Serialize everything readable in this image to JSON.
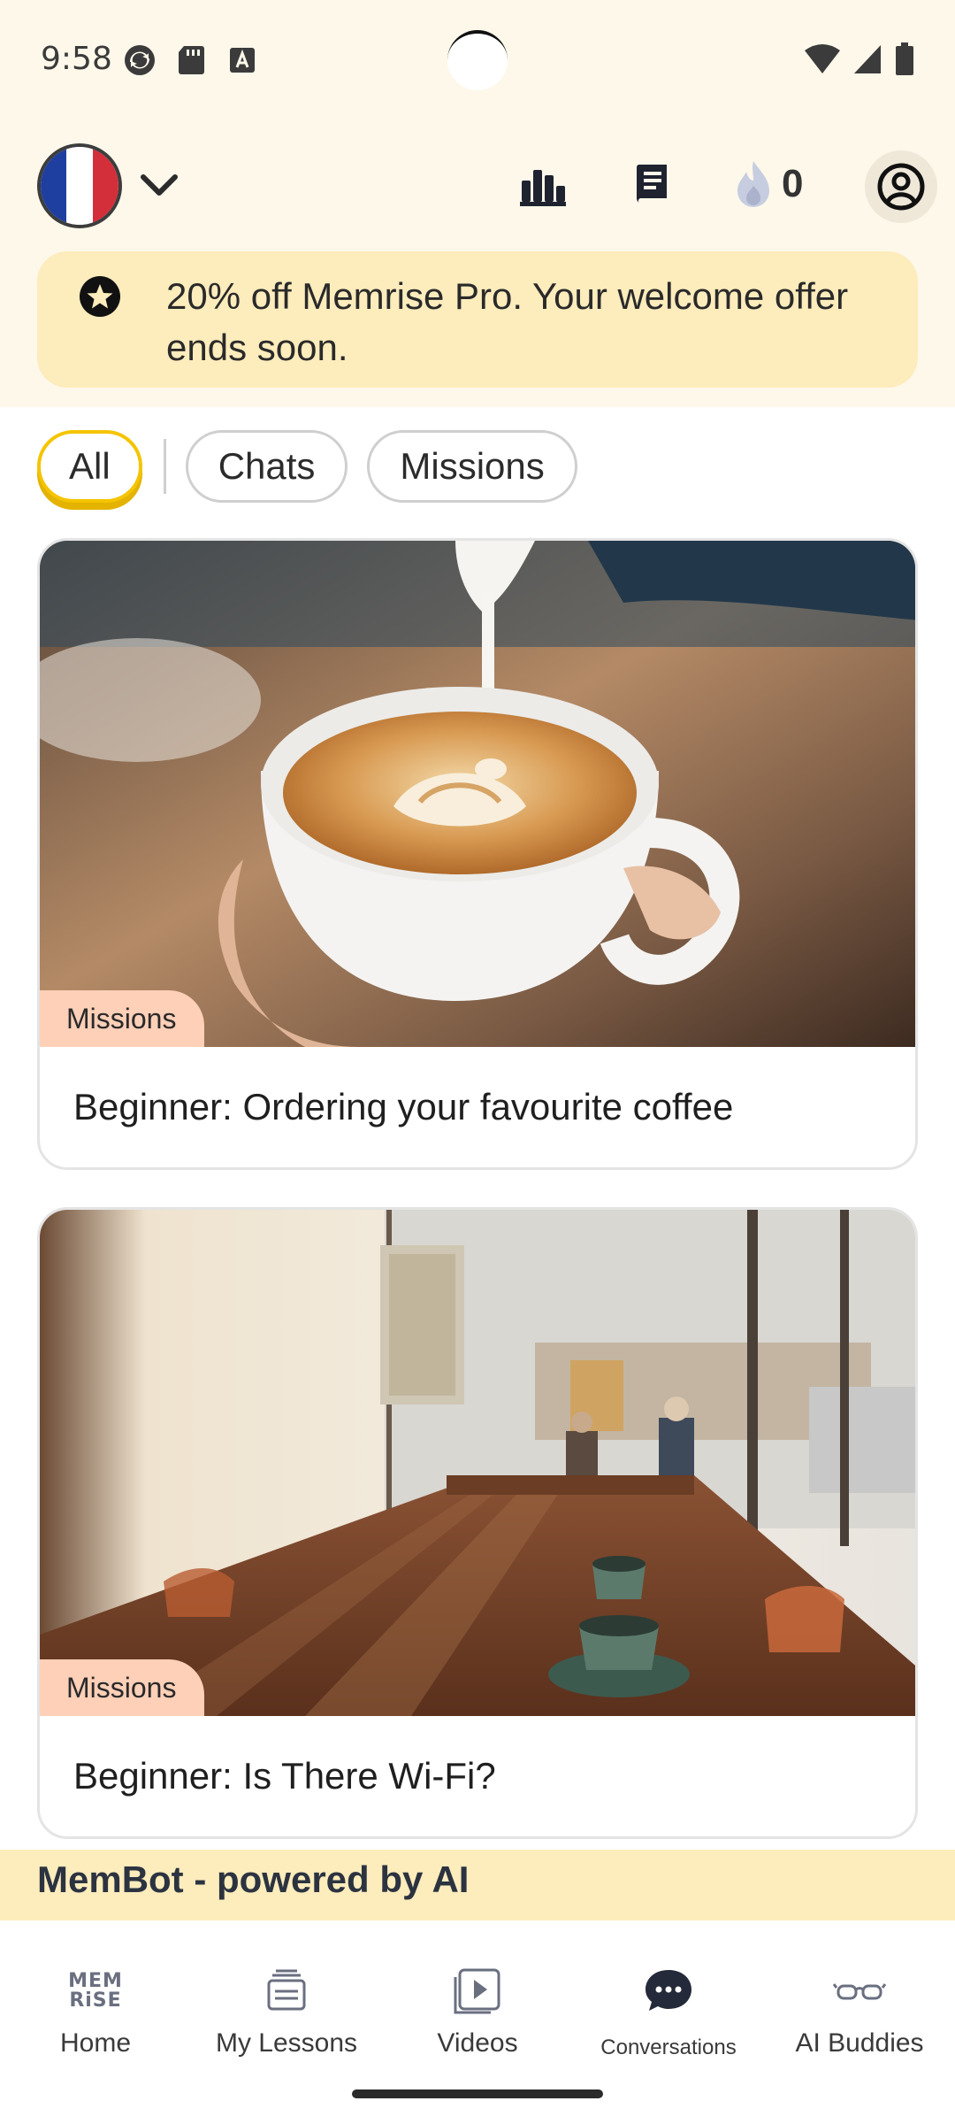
{
  "status_bar": {
    "time": "9:58",
    "left_icons": [
      "sync-icon",
      "sd-card-icon",
      "keyboard-a-icon"
    ],
    "right_icons": [
      "wifi-icon",
      "signal-icon",
      "battery-icon"
    ]
  },
  "header": {
    "language_flag": "france-flag",
    "flag_colors": [
      "#1f3fa0",
      "#ffffff",
      "#d32f3a"
    ],
    "streak_count": "0",
    "icons": [
      "leaderboard-icon",
      "dictionary-icon",
      "flame-icon",
      "account-icon"
    ]
  },
  "promo": {
    "text": "20% off Memrise Pro. Your welcome offer ends soon."
  },
  "filters": {
    "all": "All",
    "chats": "Chats",
    "missions": "Missions",
    "active": "All",
    "accent": "#f5c400"
  },
  "cards": [
    {
      "tag": "Missions",
      "title": "Beginner: Ordering your favourite coffee",
      "image": "latte-art-photo"
    },
    {
      "tag": "Missions",
      "title": "Beginner: Is There Wi-Fi?",
      "image": "cafe-table-photo"
    }
  ],
  "membot": {
    "text": "MemBot - powered by AI"
  },
  "nav": {
    "home_logo": [
      "MEM",
      "RiSE"
    ],
    "items": [
      {
        "label": "Home",
        "icon": "memrise-logo-icon"
      },
      {
        "label": "My Lessons",
        "icon": "lessons-icon"
      },
      {
        "label": "Videos",
        "icon": "video-icon"
      },
      {
        "label": "Conversations",
        "icon": "chat-bubble-icon"
      },
      {
        "label": "AI Buddies",
        "icon": "glasses-icon"
      }
    ],
    "selected": "Conversations"
  },
  "colors": {
    "header_bg": "#fdf8ea",
    "promo_bg": "#fdecbc",
    "tag_bg": "#ffd0b8"
  }
}
